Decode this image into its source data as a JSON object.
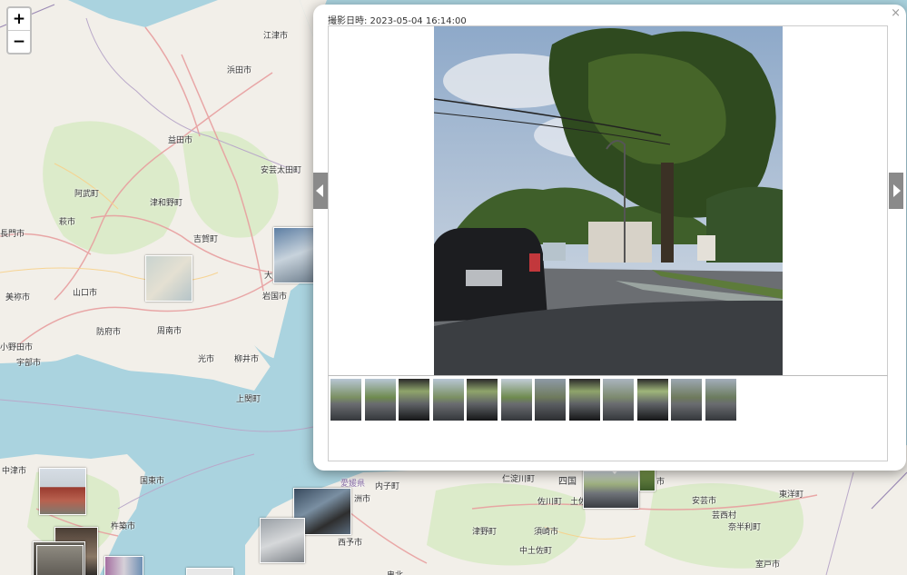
{
  "map": {
    "zoom_in": "+",
    "zoom_out": "−",
    "places": [
      {
        "name": "江津市"
      },
      {
        "name": "浜田市"
      },
      {
        "name": "益田市"
      },
      {
        "name": "安芸太田町"
      },
      {
        "name": "阿武町"
      },
      {
        "name": "津和野町"
      },
      {
        "name": "萩市"
      },
      {
        "name": "長門市"
      },
      {
        "name": "吉賀町"
      },
      {
        "name": "大"
      },
      {
        "name": "美祢市"
      },
      {
        "name": "山口市"
      },
      {
        "name": "岩国市"
      },
      {
        "name": "防府市"
      },
      {
        "name": "周南市"
      },
      {
        "name": "小野田市"
      },
      {
        "name": "宇部市"
      },
      {
        "name": "光市"
      },
      {
        "name": "柳井市"
      },
      {
        "name": "上関町"
      },
      {
        "name": "中津市"
      },
      {
        "name": "国東市"
      },
      {
        "name": "杵築市"
      },
      {
        "name": "愛媛県"
      },
      {
        "name": "内子町"
      },
      {
        "name": "仁淀川町"
      },
      {
        "name": "四国"
      },
      {
        "name": "洲市"
      },
      {
        "name": "佐川町"
      },
      {
        "name": "土佐"
      },
      {
        "name": "市"
      },
      {
        "name": "安芸市"
      },
      {
        "name": "東洋町"
      },
      {
        "name": "芸西村"
      },
      {
        "name": "奈半利町"
      },
      {
        "name": "西予市"
      },
      {
        "name": "津野町"
      },
      {
        "name": "須崎市"
      },
      {
        "name": "中土佐町"
      },
      {
        "name": "室戸市"
      },
      {
        "name": "鬼北"
      }
    ]
  },
  "popup": {
    "caption": "撮影日時: 2023-05-04 16:14:00",
    "close_symbol": "×",
    "thumbnail_count": 12
  }
}
